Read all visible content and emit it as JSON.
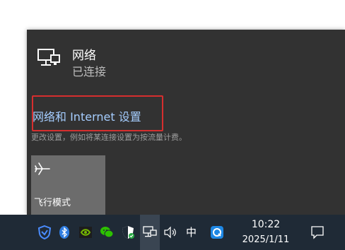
{
  "network": {
    "name": "网络",
    "status": "已连接"
  },
  "settings": {
    "link": "网络和 Internet 设置",
    "description": "更改设置，例如将某连接设置为按流量计费。"
  },
  "quick_action": {
    "airplane_label": "飞行模式"
  },
  "taskbar": {
    "ime": "中",
    "time": "10:22",
    "date": "2025/1/11",
    "icons": [
      "shield-icon",
      "bluetooth-icon",
      "nvidia-icon",
      "wechat-icon",
      "security-icon",
      "network-icon",
      "volume-icon",
      "ime",
      "qq-browser-icon",
      "notification-icon"
    ]
  },
  "colors": {
    "flyout_bg": "#323232",
    "link": "#a5cdff",
    "highlight": "#d62e2e",
    "tile": "#6c6c6c",
    "taskbar": "#1f2a36"
  }
}
